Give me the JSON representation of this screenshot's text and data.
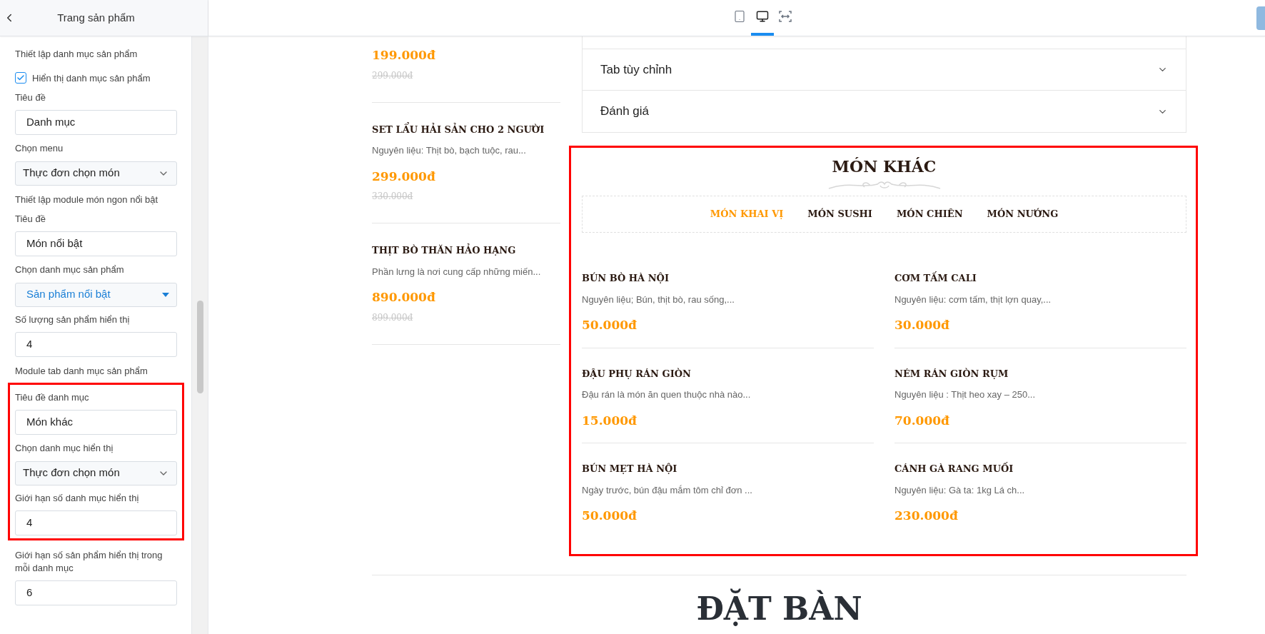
{
  "header": {
    "title": "Trang sản phẩm"
  },
  "device_tabs": [
    {
      "kind": "tablet",
      "selected": false
    },
    {
      "kind": "desktop",
      "selected": true
    },
    {
      "kind": "fullwidth",
      "selected": false
    }
  ],
  "sidebar": {
    "sections": [
      {
        "fields": [
          {
            "kind": "note",
            "text": "Thiết lập danh mục sản phẩm"
          },
          {
            "kind": "checkbox",
            "label": "Hiển thị danh mục sản phẩm",
            "checked": true
          },
          {
            "kind": "input",
            "label": "Tiêu đề",
            "value": "Danh mục"
          },
          {
            "kind": "select",
            "label": "Chọn menu",
            "value": "Thực đơn chọn món"
          },
          {
            "kind": "note",
            "text": "Thiết lập module món ngon nổi bật"
          },
          {
            "kind": "input",
            "label": "Tiêu đề",
            "value": "Món nổi bật"
          },
          {
            "kind": "dropdown",
            "label": "Chọn danh mục sản phẩm",
            "value": "Sản phẩm nổi bật"
          },
          {
            "kind": "input",
            "label": "Số lượng sản phẩm hiển thị",
            "value": "4"
          },
          {
            "kind": "note",
            "text": "Module tab danh mục sản phẩm"
          }
        ]
      },
      {
        "highlighted": true,
        "fields": [
          {
            "kind": "input",
            "label": "Tiêu đề danh mục",
            "value": "Món khác"
          },
          {
            "kind": "select",
            "label": "Chọn danh mục hiển thị",
            "value": "Thực đơn chọn món"
          },
          {
            "kind": "input",
            "label": "Giới hạn số danh mục hiển thị",
            "value": "4"
          }
        ]
      },
      {
        "fields": [
          {
            "kind": "input",
            "label": "Giới hạn số sản phẩm hiển thị trong mỗi danh mục",
            "value": "6"
          }
        ]
      }
    ]
  },
  "featured_products": [
    {
      "price": "199.000đ",
      "old_price": "299.000đ"
    },
    {
      "name": "SET LẨU HẢI SẢN CHO 2 NGƯỜI",
      "description": "Nguyên liệu: Thịt bò, bạch tuộc, rau...",
      "price": "299.000đ",
      "old_price": "330.000đ"
    },
    {
      "name": "THỊT BÒ THĂN HẢO HẠNG",
      "description": "Phần lưng là nơi cung cấp những miến...",
      "price": "890.000đ",
      "old_price": "899.000đ"
    }
  ],
  "accordion": [
    {
      "title": "Tab tùy chỉnh",
      "expanded": false
    },
    {
      "title": "Đánh giá",
      "expanded": false
    }
  ],
  "module": {
    "title": "MÓN KHÁC",
    "highlighted": true,
    "tabs": [
      {
        "label": "MÓN KHAI VỊ",
        "selected": true
      },
      {
        "label": "MÓN SUSHI",
        "selected": false
      },
      {
        "label": "MÓN CHIÊN",
        "selected": false
      },
      {
        "label": "MÓN NƯỚNG",
        "selected": false
      }
    ],
    "products": [
      {
        "name": "BÚN BÒ HÀ NỘI",
        "description": "Nguyên liệu; Bún, thịt bò, rau sống,...",
        "price": "50.000đ"
      },
      {
        "name": "CƠM TẤM CALI",
        "description": "Nguyên liệu: cơm tấm, thịt lợn quay,...",
        "price": "30.000đ"
      },
      {
        "name": "ĐẬU PHỤ RÁN GIÒN",
        "description": "Đậu rán là món ăn quen thuộc nhà nào...",
        "price": "15.000đ"
      },
      {
        "name": "NÉM RÁN GIÒN RỤM",
        "description": "Nguyên liệu : Thịt heo xay – 250...",
        "price": "70.000đ"
      },
      {
        "name": "BÚN MẸT HÀ NỘI",
        "description": "Ngày trước, bún đậu mắm tôm chỉ đơn ...",
        "price": "50.000đ"
      },
      {
        "name": "CÁNH GÀ RANG MUỐI",
        "description": "Nguyên liệu: Gà ta: 1kg Lá ch...",
        "price": "230.000đ"
      }
    ]
  },
  "next_section": {
    "title": "ĐẶT BÀN"
  }
}
